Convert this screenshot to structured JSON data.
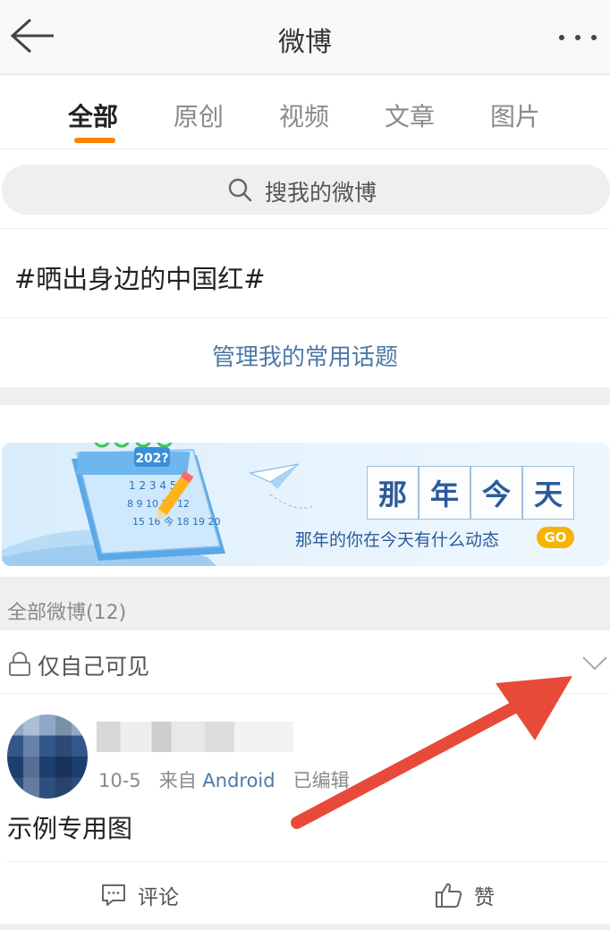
{
  "header": {
    "title": "微博"
  },
  "tabs": [
    {
      "label": "全部",
      "active": true
    },
    {
      "label": "原创",
      "active": false
    },
    {
      "label": "视频",
      "active": false
    },
    {
      "label": "文章",
      "active": false
    },
    {
      "label": "图片",
      "active": false
    }
  ],
  "search": {
    "placeholder": "搜我的微博"
  },
  "topic": {
    "text": "#晒出身边的中国红#",
    "manage_label": "管理我的常用话题"
  },
  "banner": {
    "title_chars": [
      "那",
      "年",
      "今",
      "天"
    ],
    "subtitle": "那年的你在今天有什么动态",
    "go_label": "GO",
    "calendar_year": "202?",
    "calendar_rows": [
      "1 2 3 4 5 6",
      "8 9 10 11 12",
      "15 16 今 18 19 20"
    ]
  },
  "section": {
    "title": "全部微博(12)"
  },
  "visibility": {
    "label": "仅自己可见"
  },
  "post": {
    "date": "10-5",
    "source_prefix": "来自",
    "source": "Android",
    "edited": "已编辑",
    "text": "示例专用图",
    "comment_label": "评论",
    "like_label": "赞"
  },
  "colors": {
    "accent": "#ff8200",
    "link": "#4d79a8",
    "annotation_arrow": "#e84a3a"
  }
}
